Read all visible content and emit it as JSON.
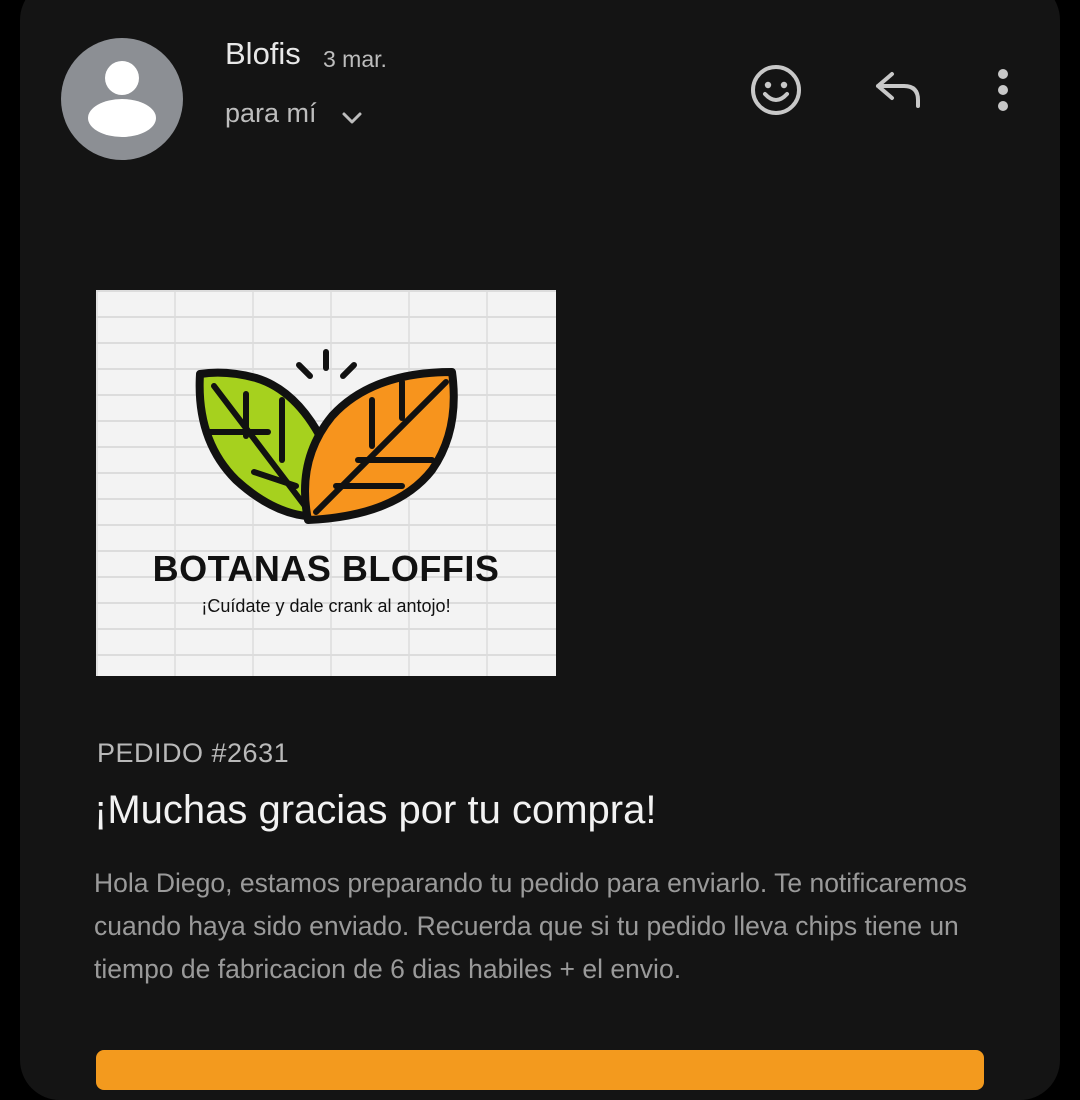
{
  "header": {
    "sender_name": "Blofis",
    "date": "3 mar.",
    "recipient": "para mí",
    "icons": [
      "avatar-person-icon",
      "chevron-down-icon",
      "emoji-reaction-icon",
      "reply-icon",
      "more-vert-icon"
    ]
  },
  "banner": {
    "brand_name": "BOTANAS BLOFFIS",
    "tagline": "¡Cuídate y dale crank al antojo!"
  },
  "body": {
    "order_number": "PEDIDO #2631",
    "headline": "¡Muchas gracias por tu compra!",
    "message": "Hola Diego, estamos preparando tu pedido para enviarlo. Te notificaremos cuando haya sido enviado. Recuerda que si tu pedido lleva chips tiene un tiempo de fabricacion de 6 dias habiles + el envio."
  },
  "colors": {
    "background": "#141414",
    "accent_orange": "#f39a1e",
    "leaf_green": "#a6d11e",
    "leaf_orange": "#f7941d",
    "avatar_gray": "#8c8f94"
  }
}
